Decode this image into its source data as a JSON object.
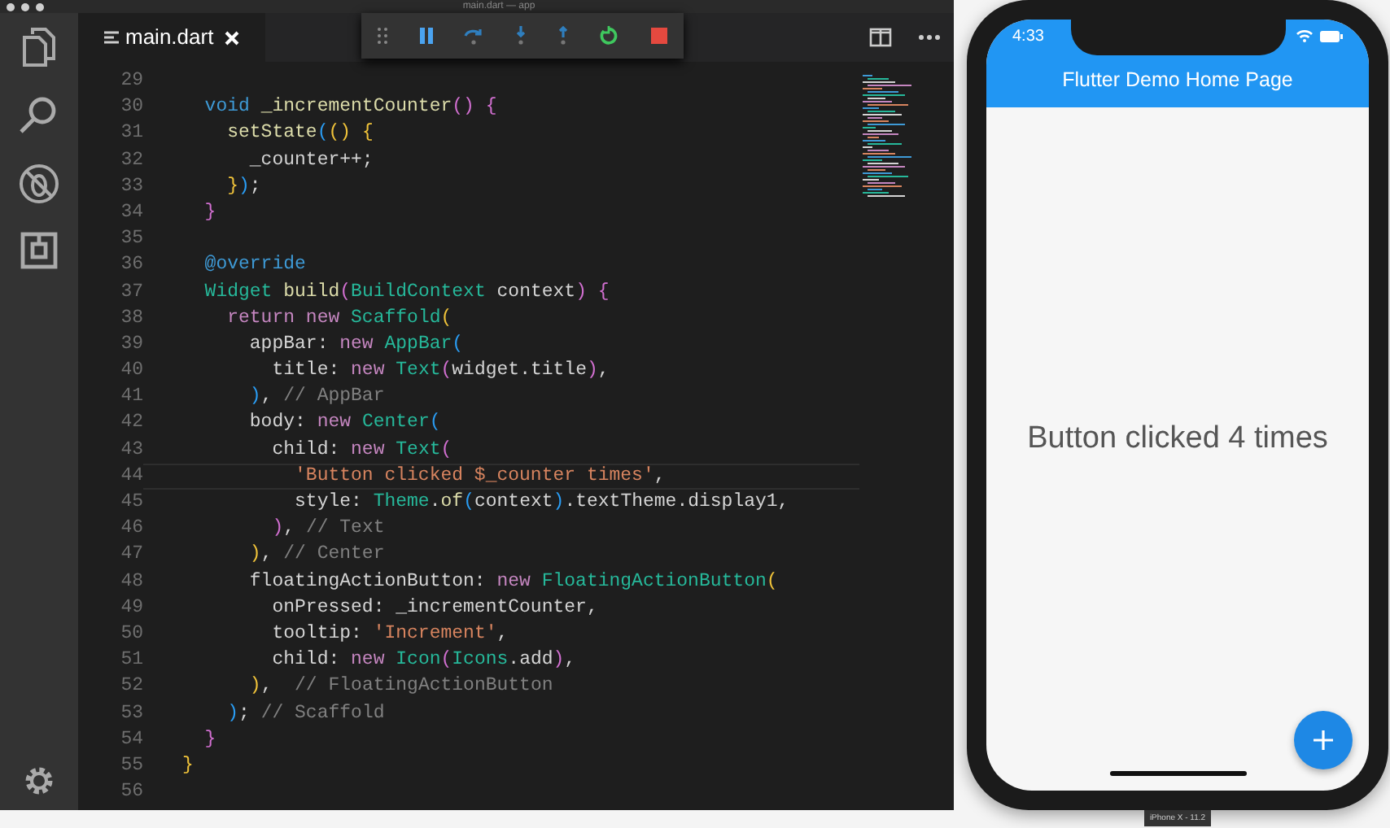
{
  "window": {
    "title": "main.dart — app"
  },
  "tab": {
    "label": "main.dart"
  },
  "editor": {
    "lines": [
      {
        "number": "29",
        "current": false
      },
      {
        "number": "30",
        "current": false,
        "tokens": [
          {
            "kind": "decl",
            "text": "  void "
          },
          {
            "kind": "func",
            "text": "_incrementCounter"
          },
          {
            "kind": "brace_pink",
            "text": "() {"
          }
        ]
      },
      {
        "number": "31",
        "current": false,
        "tokens": [
          {
            "kind": "func",
            "text": "    setState"
          },
          {
            "kind": "brace_blue",
            "text": "("
          },
          {
            "kind": "brace_yellow",
            "text": "() {"
          }
        ]
      },
      {
        "number": "32",
        "current": false,
        "tokens": [
          {
            "kind": "plain",
            "text": "      _counter++;"
          }
        ]
      },
      {
        "number": "33",
        "current": false,
        "tokens": [
          {
            "kind": "brace_yellow",
            "text": "    }"
          },
          {
            "kind": "brace_blue",
            "text": ")"
          },
          {
            "kind": "plain",
            "text": ";"
          }
        ]
      },
      {
        "number": "34",
        "current": false,
        "tokens": [
          {
            "kind": "brace_pink",
            "text": "  }"
          }
        ]
      },
      {
        "number": "35",
        "current": false
      },
      {
        "number": "36",
        "current": false,
        "tokens": [
          {
            "kind": "decl",
            "text": "  @override"
          }
        ]
      },
      {
        "number": "37",
        "current": false,
        "tokens": [
          {
            "kind": "type",
            "text": "  Widget "
          },
          {
            "kind": "func",
            "text": "build"
          },
          {
            "kind": "brace_pink",
            "text": "("
          },
          {
            "kind": "type",
            "text": "BuildContext"
          },
          {
            "kind": "plain",
            "text": " context"
          },
          {
            "kind": "brace_pink",
            "text": ") {"
          }
        ]
      },
      {
        "number": "38",
        "current": false,
        "tokens": [
          {
            "kind": "keyword",
            "text": "    return new "
          },
          {
            "kind": "type",
            "text": "Scaffold"
          },
          {
            "kind": "brace_yellow",
            "text": "("
          }
        ]
      },
      {
        "number": "39",
        "current": false,
        "tokens": [
          {
            "kind": "plain",
            "text": "      appBar: "
          },
          {
            "kind": "keyword",
            "text": "new "
          },
          {
            "kind": "type",
            "text": "AppBar"
          },
          {
            "kind": "brace_blue",
            "text": "("
          }
        ]
      },
      {
        "number": "40",
        "current": false,
        "tokens": [
          {
            "kind": "plain",
            "text": "        title: "
          },
          {
            "kind": "keyword",
            "text": "new "
          },
          {
            "kind": "type",
            "text": "Text"
          },
          {
            "kind": "brace_pink",
            "text": "("
          },
          {
            "kind": "plain",
            "text": "widget.title"
          },
          {
            "kind": "brace_pink",
            "text": ")"
          },
          {
            "kind": "plain",
            "text": ","
          }
        ]
      },
      {
        "number": "41",
        "current": false,
        "tokens": [
          {
            "kind": "brace_blue",
            "text": "      )"
          },
          {
            "kind": "plain",
            "text": ", "
          },
          {
            "kind": "comment",
            "text": "// AppBar"
          }
        ]
      },
      {
        "number": "42",
        "current": false,
        "tokens": [
          {
            "kind": "plain",
            "text": "      body: "
          },
          {
            "kind": "keyword",
            "text": "new "
          },
          {
            "kind": "type",
            "text": "Center"
          },
          {
            "kind": "brace_blue",
            "text": "("
          }
        ]
      },
      {
        "number": "43",
        "current": false,
        "tokens": [
          {
            "kind": "plain",
            "text": "        child: "
          },
          {
            "kind": "keyword",
            "text": "new "
          },
          {
            "kind": "type",
            "text": "Text"
          },
          {
            "kind": "brace_pink",
            "text": "("
          }
        ]
      },
      {
        "number": "44",
        "current": true,
        "tokens": [
          {
            "kind": "string",
            "text": "          'Button clicked $_counter times'"
          },
          {
            "kind": "plain",
            "text": ","
          }
        ]
      },
      {
        "number": "45",
        "current": false,
        "tokens": [
          {
            "kind": "plain",
            "text": "          style: "
          },
          {
            "kind": "type",
            "text": "Theme"
          },
          {
            "kind": "plain",
            "text": "."
          },
          {
            "kind": "func",
            "text": "of"
          },
          {
            "kind": "brace_blue",
            "text": "("
          },
          {
            "kind": "plain",
            "text": "context"
          },
          {
            "kind": "brace_blue",
            "text": ")"
          },
          {
            "kind": "plain",
            "text": ".textTheme.display1,"
          }
        ]
      },
      {
        "number": "46",
        "current": false,
        "tokens": [
          {
            "kind": "brace_pink",
            "text": "        )"
          },
          {
            "kind": "plain",
            "text": ", "
          },
          {
            "kind": "comment",
            "text": "// Text"
          }
        ]
      },
      {
        "number": "47",
        "current": false,
        "tokens": [
          {
            "kind": "brace_yellow",
            "text": "      )"
          },
          {
            "kind": "plain",
            "text": ", "
          },
          {
            "kind": "comment",
            "text": "// Center"
          }
        ]
      },
      {
        "number": "48",
        "current": false,
        "tokens": [
          {
            "kind": "plain",
            "text": "      floatingActionButton: "
          },
          {
            "kind": "keyword",
            "text": "new "
          },
          {
            "kind": "type",
            "text": "FloatingActionButton"
          },
          {
            "kind": "brace_yellow",
            "text": "("
          }
        ]
      },
      {
        "number": "49",
        "current": false,
        "tokens": [
          {
            "kind": "plain",
            "text": "        onPressed: _incrementCounter,"
          }
        ]
      },
      {
        "number": "50",
        "current": false,
        "tokens": [
          {
            "kind": "plain",
            "text": "        tooltip: "
          },
          {
            "kind": "string",
            "text": "'Increment'"
          },
          {
            "kind": "plain",
            "text": ","
          }
        ]
      },
      {
        "number": "51",
        "current": false,
        "tokens": [
          {
            "kind": "plain",
            "text": "        child: "
          },
          {
            "kind": "keyword",
            "text": "new "
          },
          {
            "kind": "type",
            "text": "Icon"
          },
          {
            "kind": "brace_pink",
            "text": "("
          },
          {
            "kind": "type",
            "text": "Icons"
          },
          {
            "kind": "plain",
            "text": ".add"
          },
          {
            "kind": "brace_pink",
            "text": ")"
          },
          {
            "kind": "plain",
            "text": ","
          }
        ]
      },
      {
        "number": "52",
        "current": false,
        "tokens": [
          {
            "kind": "brace_yellow",
            "text": "      )"
          },
          {
            "kind": "plain",
            "text": ",  "
          },
          {
            "kind": "comment",
            "text": "// FloatingActionButton"
          }
        ]
      },
      {
        "number": "53",
        "current": false,
        "tokens": [
          {
            "kind": "brace_blue",
            "text": "    )"
          },
          {
            "kind": "plain",
            "text": "; "
          },
          {
            "kind": "comment",
            "text": "// Scaffold"
          }
        ]
      },
      {
        "number": "54",
        "current": false,
        "tokens": [
          {
            "kind": "brace_pink",
            "text": "  }"
          }
        ]
      },
      {
        "number": "55",
        "current": false,
        "tokens": [
          {
            "kind": "brace_yellow",
            "text": "}"
          }
        ]
      },
      {
        "number": "56",
        "current": false
      }
    ]
  },
  "phone": {
    "time": "4:33",
    "app_bar_title": "Flutter Demo Home Page",
    "body_text": "Button clicked 4 times",
    "device_label": "iPhone X - 11.2"
  }
}
